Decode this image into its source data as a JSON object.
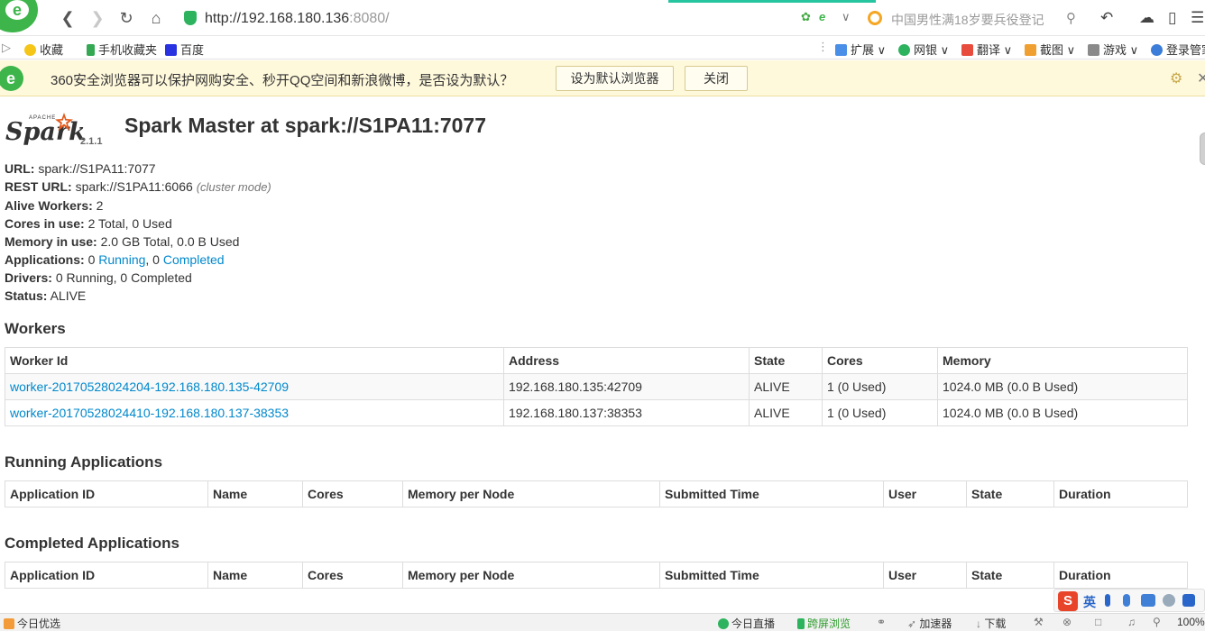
{
  "browser": {
    "url_host": "http://192.168.180.136",
    "url_port": ":8080/",
    "search_suggestion": "中国男性满18岁要兵役登记",
    "bookmarks": [
      "收藏",
      "手机收藏夹",
      "百度"
    ],
    "extensions": [
      "扩展",
      "网银",
      "翻译",
      "截图",
      "游戏",
      "登录管家"
    ],
    "notice": {
      "message": "360安全浏览器可以保护网购安全、秒开QQ空间和新浪微博，是否设为默认？",
      "set_default": "设为默认浏览器",
      "close": "关闭"
    },
    "status": {
      "left": "今日优选",
      "live": "今日直播",
      "cross_screen": "跨屏浏览",
      "accelerator": "加速器",
      "download": "下载",
      "zoom": "100%"
    },
    "ime": {
      "lang": "英"
    }
  },
  "spark": {
    "logo_apache": "APACHE",
    "logo_word": "Spark",
    "version": "2.1.1",
    "title": "Spark Master at spark://S1PA11:7077",
    "info": {
      "url_label": "URL:",
      "url_value": "spark://S1PA11:7077",
      "rest_label": "REST URL:",
      "rest_value": "spark://S1PA11:6066",
      "rest_mode": "(cluster mode)",
      "alive_label": "Alive Workers:",
      "alive_value": "2",
      "cores_label": "Cores in use:",
      "cores_value": "2 Total, 0 Used",
      "memory_label": "Memory in use:",
      "memory_value": "2.0 GB Total, 0.0 B Used",
      "apps_label": "Applications:",
      "apps_running_count": "0",
      "apps_running_link": "Running",
      "apps_completed_count": ", 0",
      "apps_completed_link": "Completed",
      "drivers_label": "Drivers:",
      "drivers_value": "0 Running, 0 Completed",
      "status_label": "Status:",
      "status_value": "ALIVE"
    },
    "workers": {
      "title": "Workers",
      "headers": [
        "Worker Id",
        "Address",
        "State",
        "Cores",
        "Memory"
      ],
      "rows": [
        [
          "worker-20170528024204-192.168.180.135-42709",
          "192.168.180.135:42709",
          "ALIVE",
          "1 (0 Used)",
          "1024.0 MB (0.0 B Used)"
        ],
        [
          "worker-20170528024410-192.168.180.137-38353",
          "192.168.180.137:38353",
          "ALIVE",
          "1 (0 Used)",
          "1024.0 MB (0.0 B Used)"
        ]
      ]
    },
    "running_apps": {
      "title": "Running Applications",
      "headers": [
        "Application ID",
        "Name",
        "Cores",
        "Memory per Node",
        "Submitted Time",
        "User",
        "State",
        "Duration"
      ]
    },
    "completed_apps": {
      "title": "Completed Applications",
      "headers": [
        "Application ID",
        "Name",
        "Cores",
        "Memory per Node",
        "Submitted Time",
        "User",
        "State",
        "Duration"
      ]
    }
  }
}
